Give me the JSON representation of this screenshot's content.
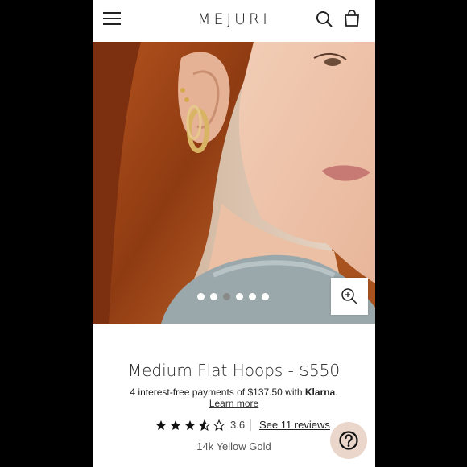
{
  "header": {
    "logo": "MEJURI",
    "icons": [
      "hamburger-menu-icon",
      "search-icon",
      "shopping-bag-icon"
    ]
  },
  "hero": {
    "carousel_dots": 6,
    "active_dot": 3,
    "zoom_icon": "zoom-in-icon"
  },
  "product": {
    "title": "Medium Flat Hoops - $550",
    "klarna_text": "4 interest-free payments of $137.50 with",
    "klarna_brand": "Klarna",
    "klarna_period": ".",
    "learn_more": "Learn more",
    "rating_value": "3.6",
    "rating_stars": 3.5,
    "reviews_link": "See 11 reviews",
    "variant": "14k Yellow Gold"
  },
  "help": {
    "icon": "question-mark-icon",
    "color": "#ead6cb"
  }
}
